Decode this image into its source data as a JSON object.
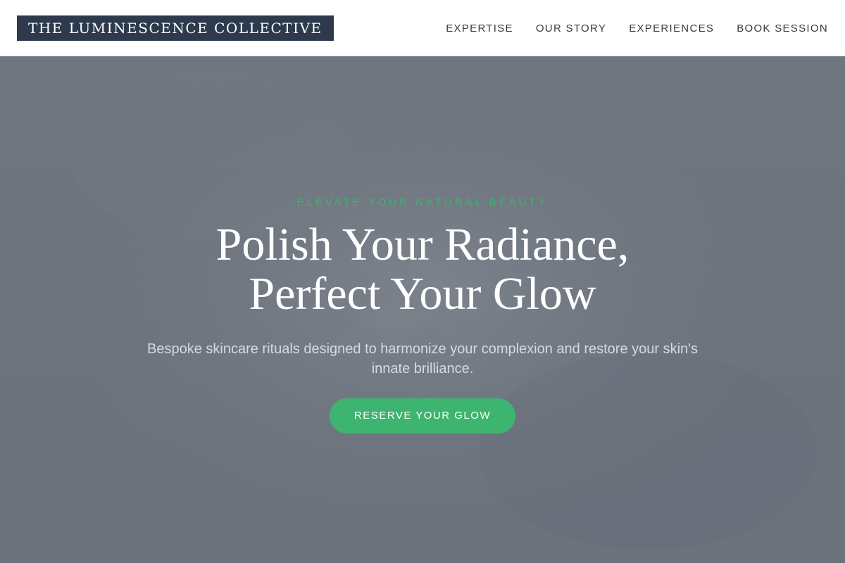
{
  "header": {
    "logo": "THE LUMINESCENCE COLLECTIVE",
    "nav": [
      {
        "label": "EXPERTISE"
      },
      {
        "label": "OUR STORY"
      },
      {
        "label": "EXPERIENCES"
      },
      {
        "label": "BOOK SESSION"
      }
    ]
  },
  "hero": {
    "eyebrow": "ELEVATE YOUR NATURAL BEAUTY",
    "headline_line1": "Polish Your Radiance,",
    "headline_line2": "Perfect Your Glow",
    "subtext": "Bespoke skincare rituals designed to harmonize your complexion and restore your skin's innate brilliance.",
    "cta_label": "RESERVE YOUR GLOW"
  },
  "colors": {
    "header_bg": "#ffffff",
    "logo_bg": "#2d3a4d",
    "hero_overlay": "#6c737d",
    "accent_green": "#3db46f"
  }
}
